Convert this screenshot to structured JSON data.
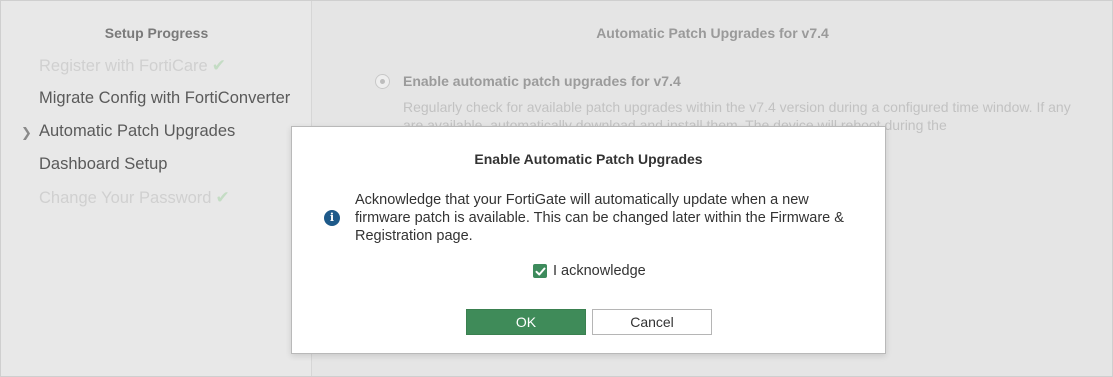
{
  "sidebar": {
    "title": "Setup Progress",
    "steps": [
      {
        "label": "Register with FortiCare",
        "status": "completed"
      },
      {
        "label": "Migrate Config with FortiConverter",
        "status": "pending"
      },
      {
        "label": "Automatic Patch Upgrades",
        "status": "current"
      },
      {
        "label": "Dashboard Setup",
        "status": "pending"
      },
      {
        "label": "Change Your Password",
        "status": "completed"
      }
    ]
  },
  "main": {
    "title": "Automatic Patch Upgrades for v7.4",
    "option_label": "Enable automatic patch upgrades for v7.4",
    "option_description": "Regularly check for available patch upgrades within the v7.4 version during a configured time window. If any are available, automatically download and install them. The device will reboot during the"
  },
  "modal": {
    "title": "Enable Automatic Patch Upgrades",
    "message": "Acknowledge that your FortiGate will automatically update when a new firmware patch is available. This can be changed later within the Firmware & Registration page.",
    "acknowledge_label": "I acknowledge",
    "acknowledge_checked": true,
    "ok_label": "OK",
    "cancel_label": "Cancel"
  },
  "icons": {
    "completed_step": "checkmark-icon",
    "current_step": "chevron-right-icon",
    "info": "info-icon"
  },
  "colors": {
    "primary_button": "#3f8b59",
    "info_icon": "#1e5a8a",
    "checkbox": "#3d8b5c"
  }
}
